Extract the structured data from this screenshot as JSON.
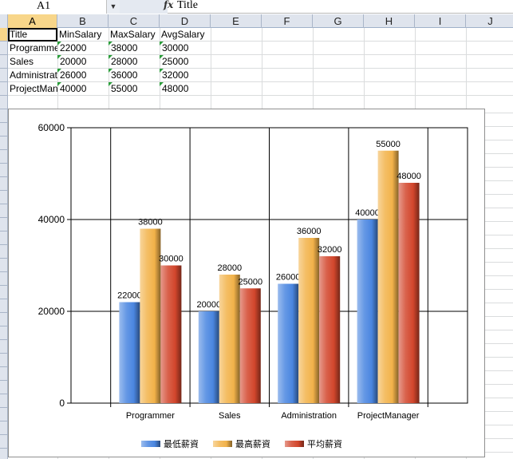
{
  "formula_bar": {
    "name_box": "A1",
    "name_arrow": "▼",
    "fx": "fx",
    "value": "Title"
  },
  "columns": [
    "A",
    "B",
    "C",
    "D",
    "E",
    "F",
    "G",
    "H",
    "I",
    "J"
  ],
  "sheet": {
    "header": [
      "Title",
      "MinSalary",
      "MaxSalary",
      "AvgSalary"
    ],
    "rows": [
      [
        "Programmer",
        "22000",
        "38000",
        "30000"
      ],
      [
        "Sales",
        "20000",
        "28000",
        "25000"
      ],
      [
        "Administrator",
        "26000",
        "36000",
        "32000"
      ],
      [
        "ProjectManager",
        "40000",
        "55000",
        "48000"
      ]
    ]
  },
  "colors": {
    "min": "#4a86e0",
    "max": "#f2b24a",
    "avg": "#d2462c"
  },
  "chart_data": {
    "type": "bar",
    "categories": [
      "Programmer",
      "Sales",
      "Administration",
      "ProjectManager"
    ],
    "series": [
      {
        "name": "最低薪資",
        "values": [
          22000,
          20000,
          26000,
          40000
        ]
      },
      {
        "name": "最高薪資",
        "values": [
          38000,
          28000,
          36000,
          55000
        ]
      },
      {
        "name": "平均薪資",
        "values": [
          30000,
          25000,
          32000,
          48000
        ]
      }
    ],
    "y_ticks": [
      "0",
      "20000",
      "40000",
      "60000"
    ],
    "ylim": [
      0,
      60000
    ],
    "grid": true,
    "legend_position": "bottom"
  }
}
